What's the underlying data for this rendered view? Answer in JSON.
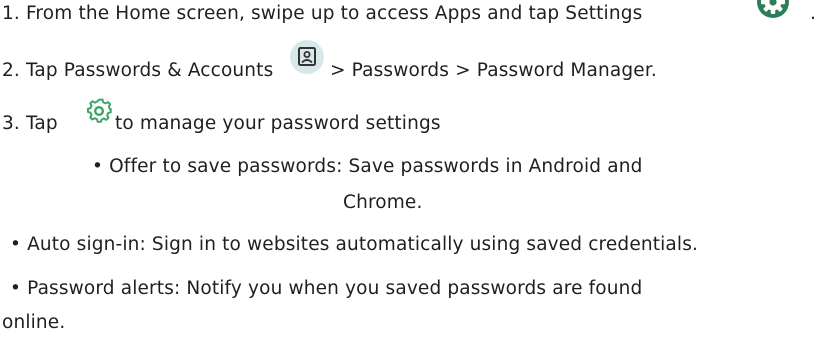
{
  "steps": {
    "step1": {
      "number": "1.",
      "text": "From the Home screen, swipe up to access Apps and tap Settings",
      "tail": "."
    },
    "step2": {
      "number": "2.",
      "text_before": "Tap Passwords & Accounts",
      "text_after": "> Passwords > Password Manager."
    },
    "step3": {
      "number": "3.",
      "text_before": "Tap",
      "text_after": "to manage your password settings"
    }
  },
  "bullets": [
    {
      "marker": "•",
      "line1": "Offer to save passwords: Save passwords in Android and",
      "line2": "Chrome."
    },
    {
      "marker": "•",
      "line1": "Auto sign-in: Sign in to websites automatically using saved credentials."
    },
    {
      "marker": "•",
      "line1": "Password alerts: Notify you when you saved passwords are found",
      "line2": "online."
    }
  ],
  "icons": {
    "settings_top": "settings-gear-icon",
    "accounts": "accounts-icon",
    "settings_inline": "settings-gear-icon",
    "settings_top_color": "#2f7d57",
    "accounts_bg_color": "#d8e7e9",
    "settings_inline_color": "#3ba466"
  }
}
